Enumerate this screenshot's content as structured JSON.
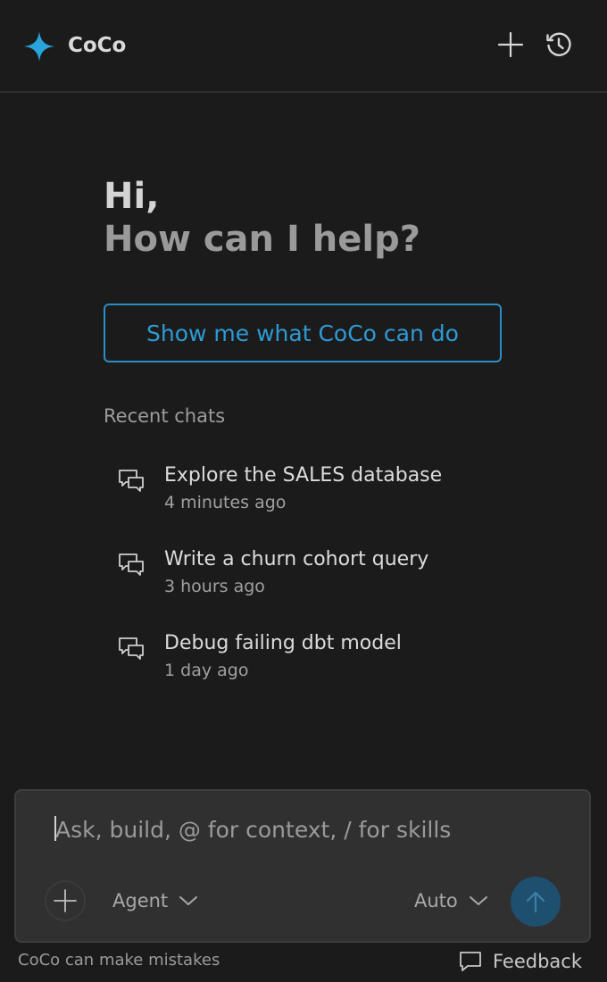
{
  "header": {
    "brand_name": "CoCo",
    "brand_icon": "sparkle-icon",
    "new_chat_icon": "plus-icon",
    "history_icon": "history-icon",
    "accent_color": "#29a3dc"
  },
  "greeting": {
    "line1": "Hi,",
    "line2": "How can I help?"
  },
  "show_button": {
    "label": "Show me what CoCo can do"
  },
  "recent": {
    "title": "Recent chats",
    "items": [
      {
        "title": "Explore the SALES database",
        "time": "4 minutes ago"
      },
      {
        "title": "Write a churn cohort query",
        "time": "3 hours ago"
      },
      {
        "title": "Debug failing dbt model",
        "time": "1 day ago"
      }
    ]
  },
  "composer": {
    "placeholder": "Ask, build, @ for context, / for skills",
    "value": "",
    "mode": "Agent",
    "model": "Auto",
    "send_color": "#1e4f6e"
  },
  "footer": {
    "disclaimer": "CoCo can make mistakes",
    "feedback_label": "Feedback"
  }
}
